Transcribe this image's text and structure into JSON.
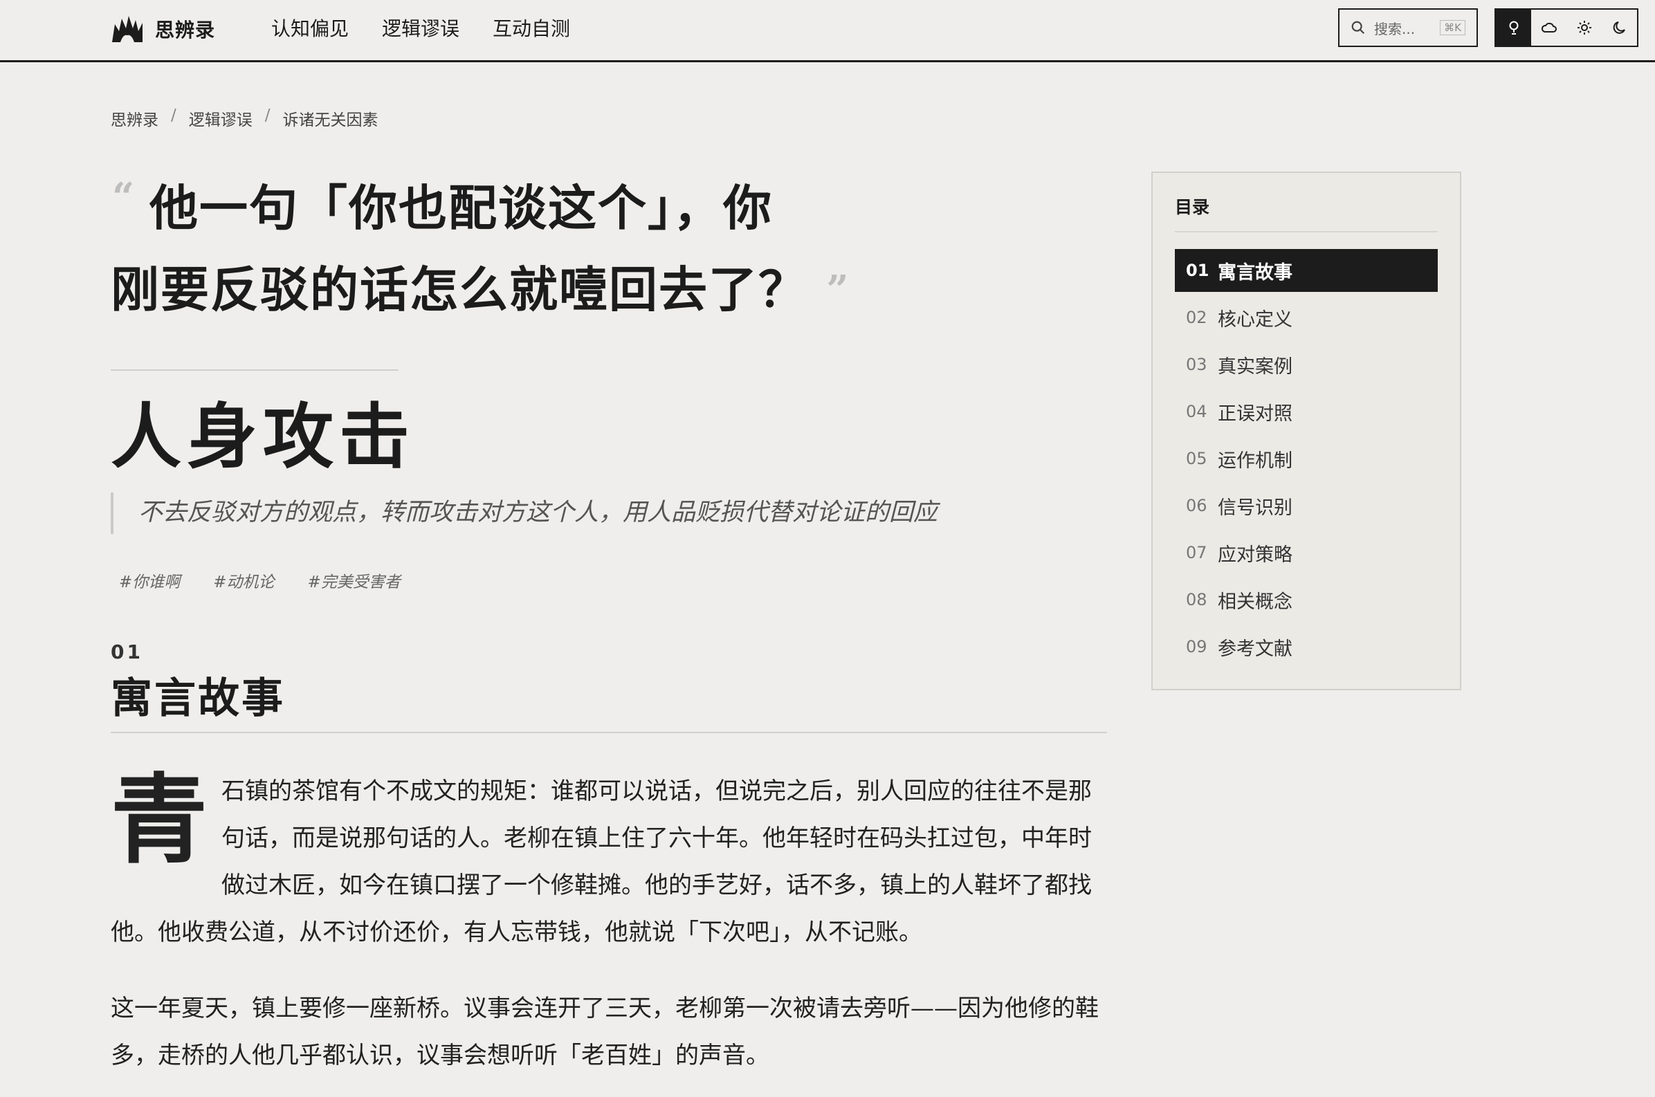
{
  "brand": {
    "name": "思辨录"
  },
  "nav": [
    "认知偏见",
    "逻辑谬误",
    "互动自测"
  ],
  "search": {
    "placeholder": "搜索...",
    "shortcut": "⌘K"
  },
  "toolbar": {
    "buttons": [
      "lightbulb-icon",
      "cloud-icon",
      "sun-icon",
      "moon-icon"
    ],
    "active": 0
  },
  "breadcrumb": [
    "思辨录",
    "逻辑谬误",
    "诉诸无关因素"
  ],
  "quote": {
    "open_mark": "“",
    "line1": "他一句「你也配谈这个」，你",
    "line2": "刚要反驳的话怎么就噎回去了？",
    "close_mark": "”"
  },
  "concept": {
    "title": "人身攻击",
    "definition": "不去反驳对方的观点，转而攻击对方这个人，用人品贬损代替对论证的回应",
    "tags": [
      "#你谁啊",
      "#动机论",
      "#完美受害者"
    ]
  },
  "section": {
    "number": "01",
    "title": "寓言故事",
    "dropcap": "青",
    "paragraph1": "石镇的茶馆有个不成文的规矩：谁都可以说话，但说完之后，别人回应的往往不是那句话，而是说那句话的人。老柳在镇上住了六十年。他年轻时在码头扛过包，中年时做过木匠，如今在镇口摆了一个修鞋摊。他的手艺好，话不多，镇上的人鞋坏了都找他。他收费公道，从不讨价还价，有人忘带钱，他就说「下次吧」，从不记账。",
    "paragraph2": "这一年夏天，镇上要修一座新桥。议事会连开了三天，老柳第一次被请去旁听——因为他修的鞋多，走桥的人他几乎都认识，议事会想听听「老百姓」的声音。"
  },
  "toc": {
    "title": "目录",
    "items": [
      {
        "num": "01",
        "label": "寓言故事"
      },
      {
        "num": "02",
        "label": "核心定义"
      },
      {
        "num": "03",
        "label": "真实案例"
      },
      {
        "num": "04",
        "label": "正误对照"
      },
      {
        "num": "05",
        "label": "运作机制"
      },
      {
        "num": "06",
        "label": "信号识别"
      },
      {
        "num": "07",
        "label": "应对策略"
      },
      {
        "num": "08",
        "label": "相关概念"
      },
      {
        "num": "09",
        "label": "参考文献"
      }
    ],
    "active_index": 0
  },
  "colors": {
    "background": "#efeeec",
    "ink": "#1c1c1c",
    "muted": "#666666"
  }
}
